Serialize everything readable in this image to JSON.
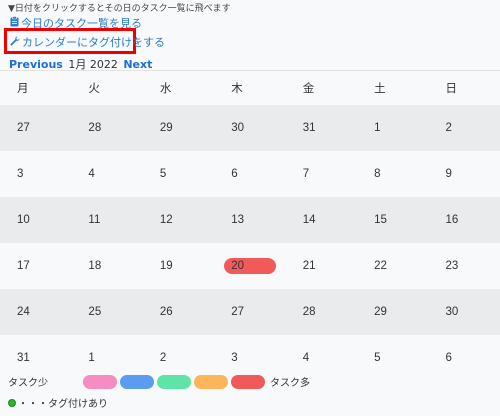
{
  "hint": "▼日付をクリックするとその日のタスク一覧に飛べます",
  "links": {
    "today_icon": "clipboard-icon",
    "today": "今日のタスク一覧を見る",
    "tag_icon": "wrench-icon",
    "tag_calendar": "カレンダーにタグ付けをする"
  },
  "nav": {
    "previous": "Previous",
    "month": "1月 2022",
    "next": "Next"
  },
  "weekdays": [
    "月",
    "火",
    "水",
    "木",
    "金",
    "土",
    "日"
  ],
  "weeks": [
    [
      "27",
      "28",
      "29",
      "30",
      "31",
      "1",
      "2"
    ],
    [
      "3",
      "4",
      "5",
      "6",
      "7",
      "8",
      "9"
    ],
    [
      "10",
      "11",
      "12",
      "13",
      "14",
      "15",
      "16"
    ],
    [
      "17",
      "18",
      "19",
      "20",
      "21",
      "22",
      "23"
    ],
    [
      "24",
      "25",
      "26",
      "27",
      "28",
      "29",
      "30"
    ],
    [
      "31",
      "1",
      "2",
      "3",
      "4",
      "5",
      "6"
    ]
  ],
  "highlighted_day": {
    "week": 3,
    "day": 3,
    "color": "#f05a5a"
  },
  "legend": {
    "low_label": "タスク少",
    "high_label": "タスク多",
    "colors": [
      "#f58cc2",
      "#5b9cf0",
      "#5ee3a8",
      "#fdb55c",
      "#f05a5a"
    ]
  },
  "tag_note": "・・・タグ付けあり",
  "tag_dot_color": "#2db52d"
}
